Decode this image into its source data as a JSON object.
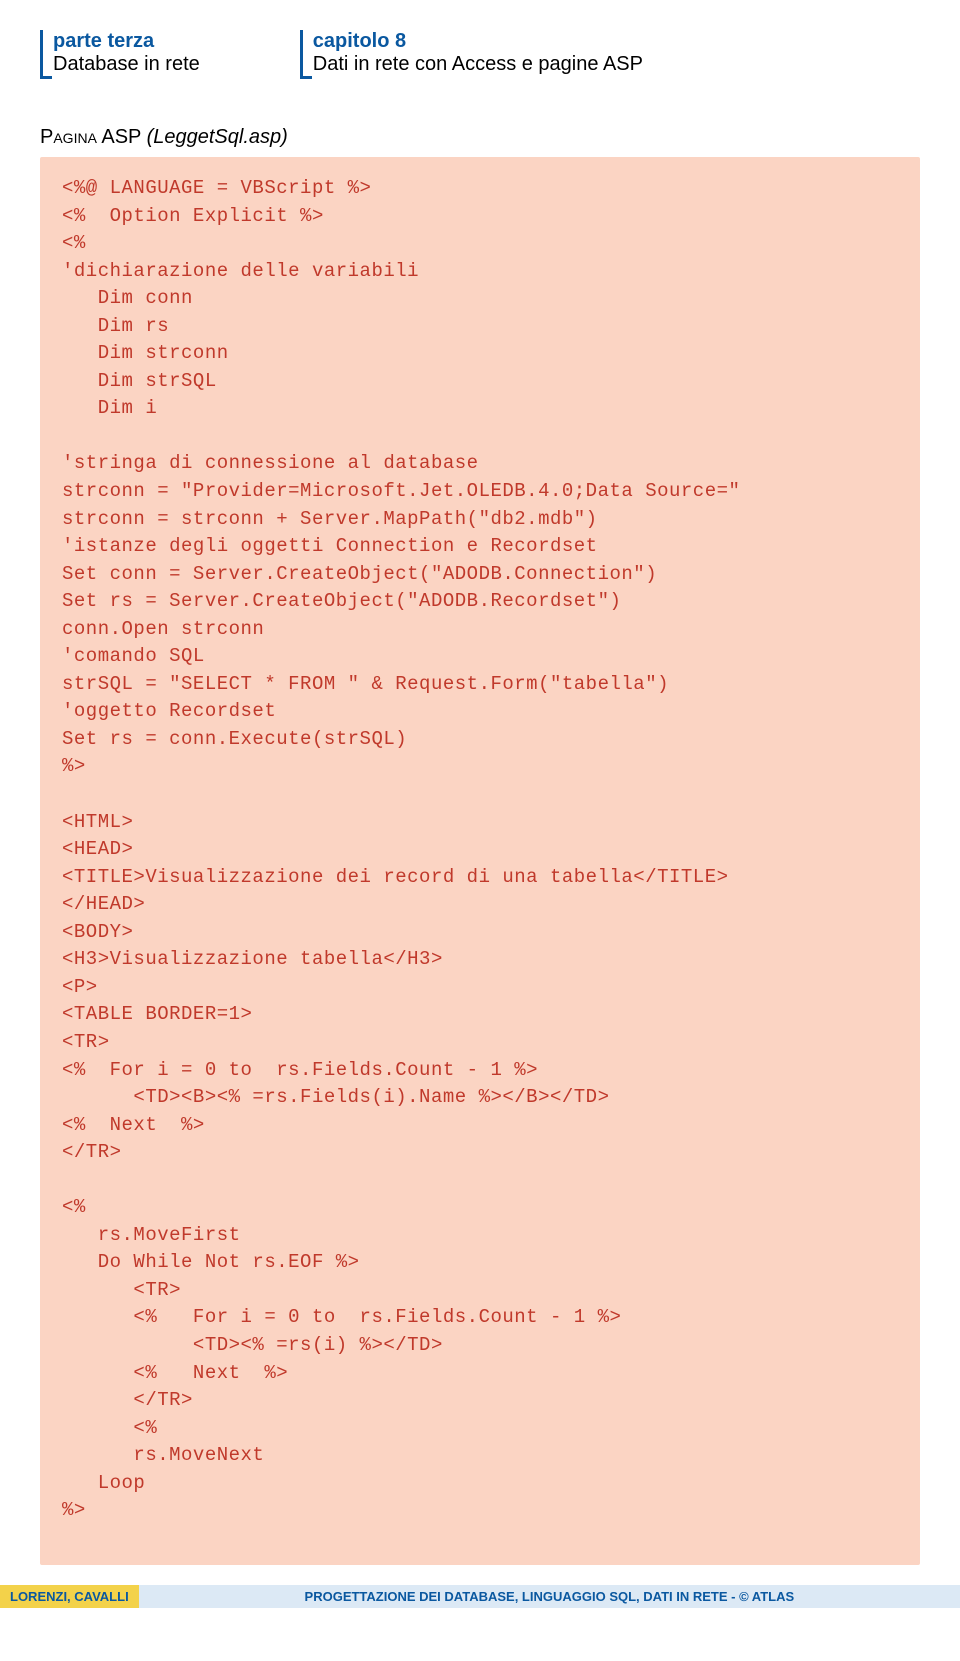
{
  "header": {
    "left_title": "parte terza",
    "left_sub": "Database in rete",
    "right_title": "capitolo 8",
    "right_sub": "Dati in rete con Access e pagine ASP"
  },
  "section": {
    "label": "Pagina",
    "tech": " ASP ",
    "file": "(LeggetSql.asp)"
  },
  "code": "<%@ LANGUAGE = VBScript %>\n<%  Option Explicit %>\n<%\n'dichiarazione delle variabili\n   Dim conn\n   Dim rs\n   Dim strconn\n   Dim strSQL\n   Dim i\n\n'stringa di connessione al database\nstrconn = \"Provider=Microsoft.Jet.OLEDB.4.0;Data Source=\"\nstrconn = strconn + Server.MapPath(\"db2.mdb\")\n'istanze degli oggetti Connection e Recordset\nSet conn = Server.CreateObject(\"ADODB.Connection\")\nSet rs = Server.CreateObject(\"ADODB.Recordset\")\nconn.Open strconn\n'comando SQL\nstrSQL = \"SELECT * FROM \" & Request.Form(\"tabella\")\n'oggetto Recordset\nSet rs = conn.Execute(strSQL)\n%>\n\n<HTML>\n<HEAD>\n<TITLE>Visualizzazione dei record di una tabella</TITLE>\n</HEAD>\n<BODY>\n<H3>Visualizzazione tabella</H3>\n<P>\n<TABLE BORDER=1>\n<TR>\n<%  For i = 0 to  rs.Fields.Count - 1 %>\n      <TD><B><% =rs.Fields(i).Name %></B></TD>\n<%  Next  %>\n</TR>\n\n<%\n   rs.MoveFirst\n   Do While Not rs.EOF %>\n      <TR>\n      <%   For i = 0 to  rs.Fields.Count - 1 %>\n           <TD><% =rs(i) %></TD>\n      <%   Next  %>\n      </TR>\n      <%\n      rs.MoveNext\n   Loop\n%>",
  "footer": {
    "authors": "LORENZI, CAVALLI",
    "book": "PROGETTAZIONE DEI DATABASE, LINGUAGGIO SQL, DATI IN RETE - © ATLAS"
  }
}
